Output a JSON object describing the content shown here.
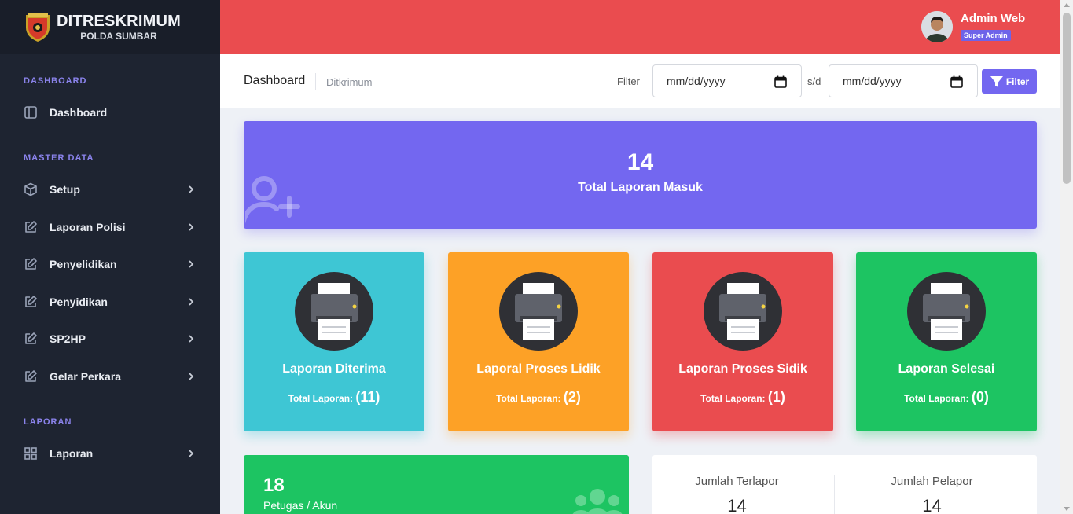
{
  "brand": {
    "title": "DITRESKRIMUM",
    "subtitle": "POLDA SUMBAR",
    "logo_icon": "police-shield-logo"
  },
  "sidebar": {
    "sections": [
      {
        "title": "DASHBOARD",
        "items": [
          {
            "label": "Dashboard",
            "icon": "layout-icon",
            "has_submenu": false
          }
        ]
      },
      {
        "title": "MASTER DATA",
        "items": [
          {
            "label": "Setup",
            "icon": "box-icon",
            "has_submenu": true
          },
          {
            "label": "Laporan Polisi",
            "icon": "edit-icon",
            "has_submenu": true
          },
          {
            "label": "Penyelidikan",
            "icon": "edit-icon",
            "has_submenu": true
          },
          {
            "label": "Penyidikan",
            "icon": "edit-icon",
            "has_submenu": true
          },
          {
            "label": "SP2HP",
            "icon": "edit-icon",
            "has_submenu": true
          },
          {
            "label": "Gelar Perkara",
            "icon": "edit-icon",
            "has_submenu": true
          }
        ]
      },
      {
        "title": "LAPORAN",
        "items": [
          {
            "label": "Laporan",
            "icon": "grid-icon",
            "has_submenu": true
          }
        ]
      }
    ]
  },
  "header": {
    "user_name": "Admin Web",
    "user_role": "Super Admin"
  },
  "subheader": {
    "title": "Dashboard",
    "breadcrumb": "Ditkrimum",
    "filter_label": "Filter",
    "date_from_placeholder": "mm/dd/yyyy",
    "separator_label": "s/d",
    "date_to_placeholder": "mm/dd/yyyy",
    "filter_button": "Filter"
  },
  "banner": {
    "value": "14",
    "label": "Total Laporan Masuk"
  },
  "cards": [
    {
      "title": "Laporan Diterima",
      "count_label": "Total Laporan:",
      "count": "(11)",
      "color": "#3ec6d4"
    },
    {
      "title": "Laporal Proses Lidik",
      "count_label": "Total Laporan:",
      "count": "(2)",
      "color": "#fda126"
    },
    {
      "title": "Laporan Proses Sidik",
      "count_label": "Total Laporan:",
      "count": "(1)",
      "color": "#ea4c4f"
    },
    {
      "title": "Laporan Selesai",
      "count_label": "Total Laporan:",
      "count": "(0)",
      "color": "#1dc462"
    }
  ],
  "staff": {
    "value": "18",
    "label": "Petugas / Akun"
  },
  "stats": [
    {
      "label": "Jumlah Terlapor",
      "value": "14"
    },
    {
      "label": "Jumlah Pelapor",
      "value": "14"
    }
  ],
  "colors": {
    "sidebar": "#1e2431",
    "header": "#ea4c4f",
    "primary": "#7367f0",
    "section_title": "#8b83ec"
  }
}
